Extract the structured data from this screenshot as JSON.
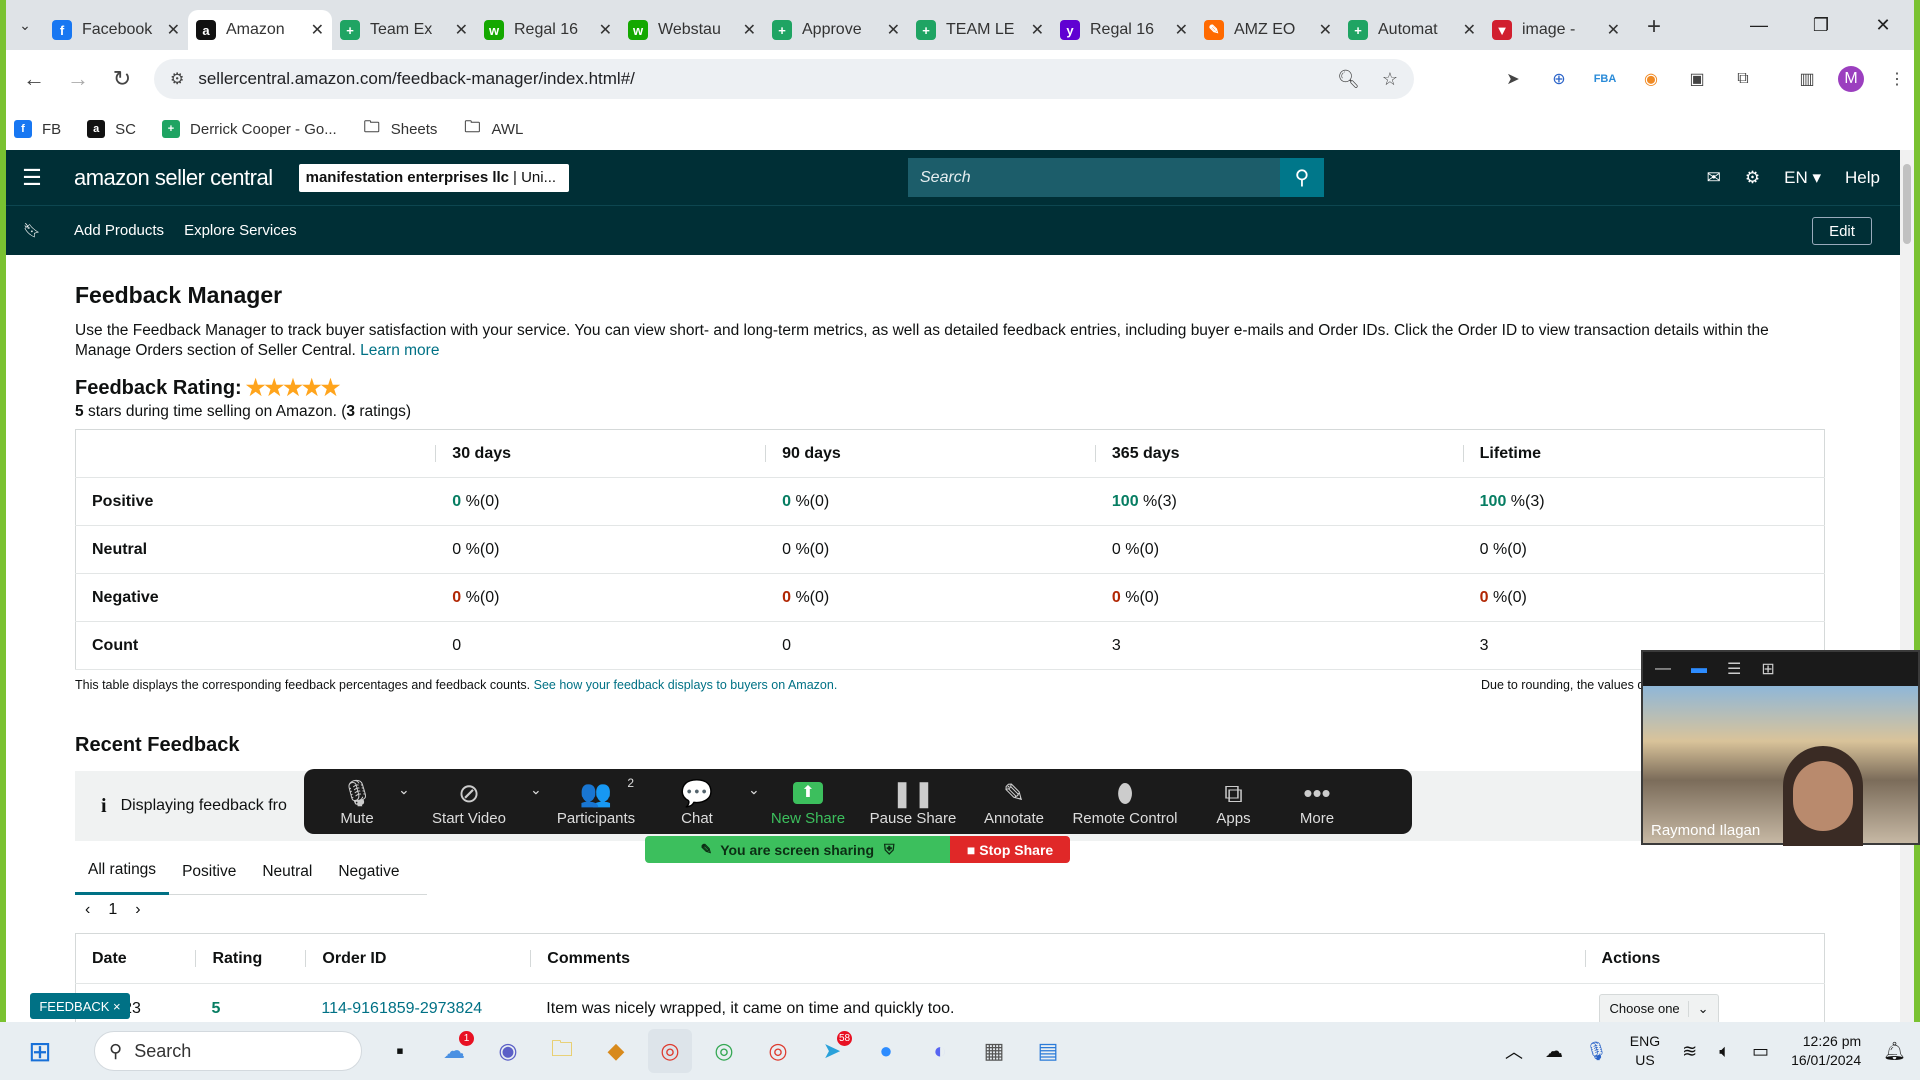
{
  "browser": {
    "tabs": [
      {
        "title": "Facebook",
        "icon": "facebook-icon",
        "color": "#1877f2",
        "glyph": "f"
      },
      {
        "title": "Amazon",
        "icon": "amazon-icon",
        "color": "#111111",
        "glyph": "a",
        "active": true
      },
      {
        "title": "Team Ex",
        "icon": "google-sheets-icon",
        "color": "#1fa463",
        "glyph": "+"
      },
      {
        "title": "Regal 16",
        "icon": "upwork-icon",
        "color": "#14a800",
        "glyph": "w"
      },
      {
        "title": "Webstau",
        "icon": "upwork-icon",
        "color": "#14a800",
        "glyph": "w"
      },
      {
        "title": "Approve",
        "icon": "google-sheets-icon",
        "color": "#1fa463",
        "glyph": "+"
      },
      {
        "title": "TEAM LE",
        "icon": "google-sheets-icon",
        "color": "#1fa463",
        "glyph": "+"
      },
      {
        "title": "Regal 16",
        "icon": "yahoo-icon",
        "color": "#6001d2",
        "glyph": "y"
      },
      {
        "title": "AMZ EO",
        "icon": "pen-icon",
        "color": "#ff6a00",
        "glyph": "✎"
      },
      {
        "title": "Automat",
        "icon": "google-sheets-icon",
        "color": "#1fa463",
        "glyph": "+"
      },
      {
        "title": "image -",
        "icon": "vivaldi-icon",
        "color": "#d11f2e",
        "glyph": "▼"
      }
    ],
    "url": "sellercentral.amazon.com/feedback-manager/index.html#/",
    "profile_initial": "M",
    "bookmarks": [
      {
        "label": "FB",
        "icon": "facebook-icon",
        "color": "#1877f2",
        "glyph": "f"
      },
      {
        "label": "SC",
        "icon": "amazon-icon",
        "color": "#111111",
        "glyph": "a"
      },
      {
        "label": "Derrick Cooper - Go...",
        "icon": "google-sheets-icon",
        "color": "#1fa463",
        "glyph": "+"
      },
      {
        "label": "Sheets",
        "icon": "folder-icon",
        "color": "transparent",
        "glyph": "🗀"
      },
      {
        "label": "AWL",
        "icon": "folder-icon",
        "color": "transparent",
        "glyph": "🗀"
      }
    ]
  },
  "seller": {
    "logo": "amazon seller central",
    "account_bold": "manifestation enterprises llc",
    "account_rest": "| Uni...",
    "search_placeholder": "Search",
    "lang": "EN",
    "help": "Help",
    "nav": [
      "Add Products",
      "Explore Services"
    ],
    "edit": "Edit"
  },
  "page": {
    "title": "Feedback Manager",
    "description": "Use the Feedback Manager to track buyer satisfaction with your service. You can view short- and long-term metrics, as well as detailed feedback entries, including buyer e-mails and Order IDs. Click the Order ID to view transaction details within the Manage Orders section of Seller Central.",
    "learn_more": "Learn more",
    "rating_label": "Feedback Rating:",
    "stars": "★★★★★",
    "rating_stars_bold": "5",
    "rating_sub_mid": "stars during time selling on Amazon. (",
    "rating_count": "3",
    "rating_sub_end": "ratings)",
    "metrics": {
      "headers": [
        "30 days",
        "90 days",
        "365 days",
        "Lifetime"
      ],
      "rows": [
        {
          "label": "Positive",
          "type": "pos",
          "cells": [
            [
              "0",
              " %(0)"
            ],
            [
              "0",
              " %(0)"
            ],
            [
              "100",
              " %(3)"
            ],
            [
              "100",
              " %(3)"
            ]
          ]
        },
        {
          "label": "Neutral",
          "type": "neu",
          "cells": [
            [
              "0",
              " %(0)"
            ],
            [
              "0",
              " %(0)"
            ],
            [
              "0",
              " %(0)"
            ],
            [
              "0",
              " %(0)"
            ]
          ]
        },
        {
          "label": "Negative",
          "type": "neg",
          "cells": [
            [
              "0",
              " %(0)"
            ],
            [
              "0",
              " %(0)"
            ],
            [
              "0",
              " %(0)"
            ],
            [
              "0",
              " %(0)"
            ]
          ]
        },
        {
          "label": "Count",
          "type": "cnt",
          "cells": [
            [
              "0",
              ""
            ],
            [
              "0",
              ""
            ],
            [
              "3",
              ""
            ],
            [
              "3",
              ""
            ]
          ]
        }
      ]
    },
    "table_note": "This table displays the corresponding feedback percentages and feedback counts.",
    "table_note_link": "See how your feedback displays to buyers on Amazon.",
    "rounding_note": "Due to rounding, the values displa",
    "recent_title": "Recent Feedback",
    "alert_text": "Displaying feedback fro",
    "filter_tabs": [
      "All ratings",
      "Positive",
      "Neutral",
      "Negative"
    ],
    "pager": {
      "prev": "‹",
      "page": "1",
      "next": "›"
    },
    "feedback_headers": [
      "Date",
      "Rating",
      "Order ID",
      "Comments",
      "Actions"
    ],
    "feedback_rows": [
      {
        "date": "5/2023",
        "rating": "5",
        "order_id": "114-9161859-2973824",
        "comment": "Item was nicely wrapped, it came on time and quickly too.",
        "action": "Choose one"
      }
    ],
    "feedback_tag": "FEEDBACK ×"
  },
  "zoom": {
    "items": [
      {
        "label": "Mute",
        "icon": "microphone-icon",
        "glyph": "🎙",
        "caret": true
      },
      {
        "label": "Start Video",
        "icon": "video-off-icon",
        "glyph": "⊘",
        "caret": true
      },
      {
        "label": "Participants",
        "icon": "participants-icon",
        "glyph": "👥",
        "count": "2"
      },
      {
        "label": "Chat",
        "icon": "chat-icon",
        "glyph": "💬",
        "caret": true
      },
      {
        "label": "New Share",
        "icon": "share-icon",
        "glyph": "⬆",
        "green": true
      },
      {
        "label": "Pause Share",
        "icon": "pause-icon",
        "glyph": "❚❚"
      },
      {
        "label": "Annotate",
        "icon": "pencil-icon",
        "glyph": "✎"
      },
      {
        "label": "Remote Control",
        "icon": "mouse-icon",
        "glyph": "⬮"
      },
      {
        "label": "Apps",
        "icon": "apps-icon",
        "glyph": "⧉"
      },
      {
        "label": "More",
        "icon": "more-icon",
        "glyph": "•••"
      }
    ],
    "sharing_text": "You are screen sharing",
    "stop_share": "Stop Share",
    "participant_name": "Raymond Ilagan"
  },
  "taskbar": {
    "search": "Search",
    "lang": "ENG",
    "region": "US",
    "time": "12:26 pm",
    "date": "16/01/2024",
    "badges": {
      "weather": "1",
      "telegram": "58"
    }
  }
}
